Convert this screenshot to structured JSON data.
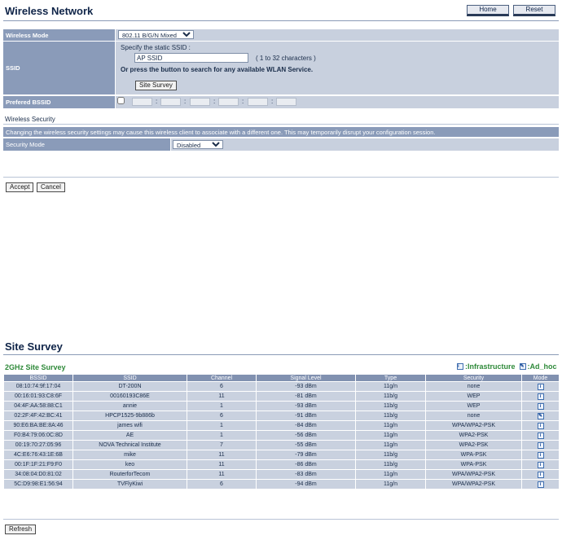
{
  "header": {
    "title": "Wireless Network",
    "home_label": "Home",
    "reset_label": "Reset"
  },
  "wireless": {
    "mode_label": "Wireless Mode",
    "mode_value": "802.11 B/G/N Mixed",
    "ssid_label": "SSID",
    "ssid_specify": "Specify the static SSID  :",
    "ssid_value": "AP SSID",
    "ssid_hint": "( 1 to 32 characters )",
    "ssid_or": "Or press the button to search for any available WLAN Service.",
    "site_survey_button": "Site Survey",
    "preferred_label": "Prefered BSSID",
    "bssid_sep": ":"
  },
  "security": {
    "title": "Wireless Security",
    "warning": "Changing the wireless security settings may cause this wireless client to associate with a different one. This may temporarily disrupt your configuration session.",
    "mode_label": "Security Mode",
    "mode_value": "Disabled"
  },
  "actions": {
    "accept": "Accept",
    "cancel": "Cancel"
  },
  "survey": {
    "title": "Site Survey",
    "subtitle": "2GHz Site Survey",
    "legend_infra": ":Infrastructure",
    "legend_adhoc": ":Ad_hoc",
    "columns": [
      "BSSID",
      "SSID",
      "Channel",
      "Signal Level",
      "Type",
      "Security",
      "Mode"
    ],
    "rows": [
      [
        "08:10:74:9f:17:04",
        "DT-200N",
        "6",
        "-93 dBm",
        "11g/n",
        "none",
        "infrastructure"
      ],
      [
        "00:16:01:93:C8:6F",
        "00160193C86E",
        "11",
        "-81 dBm",
        "11b/g",
        "WEP",
        "infrastructure"
      ],
      [
        "04:4F:AA:58:88:C1",
        "annie",
        "1",
        "-93 dBm",
        "11b/g",
        "WEP",
        "infrastructure"
      ],
      [
        "02:2F:4F:42:BC:41",
        "HPCP1525-9b886b",
        "6",
        "-91 dBm",
        "11b/g",
        "none",
        "adhoc"
      ],
      [
        "90:E6:BA:BE:8A:46",
        "james wifi",
        "1",
        "-84 dBm",
        "11g/n",
        "WPA/WPA2-PSK",
        "infrastructure"
      ],
      [
        "F0:B4:79:06:0C:8D",
        "AE",
        "1",
        "-56 dBm",
        "11g/n",
        "WPA2-PSK",
        "infrastructure"
      ],
      [
        "00:19:70:27:05:96",
        "NOVA Technical Institute",
        "7",
        "-55 dBm",
        "11g/n",
        "WPA2-PSK",
        "infrastructure"
      ],
      [
        "4C:E6:76:43:1E:6B",
        "mike",
        "11",
        "-79 dBm",
        "11b/g",
        "WPA-PSK",
        "infrastructure"
      ],
      [
        "00:1F:1F:21:F9:F0",
        "keo",
        "11",
        "-86 dBm",
        "11b/g",
        "WPA-PSK",
        "infrastructure"
      ],
      [
        "34:08:04:D0:81:02",
        "RouterforTecom",
        "11",
        "-83 dBm",
        "11g/n",
        "WPA/WPA2-PSK",
        "infrastructure"
      ],
      [
        "5C:D9:98:E1:56:94",
        "TVFlyKiwi",
        "6",
        "-94 dBm",
        "11g/n",
        "WPA/WPA2-PSK",
        "infrastructure"
      ]
    ],
    "refresh_label": "Refresh"
  },
  "colors": {
    "label_bg": "#8a9bb9",
    "value_bg": "#c8d0de",
    "accent_green": "#2f8a3a",
    "title": "#0f2448"
  }
}
